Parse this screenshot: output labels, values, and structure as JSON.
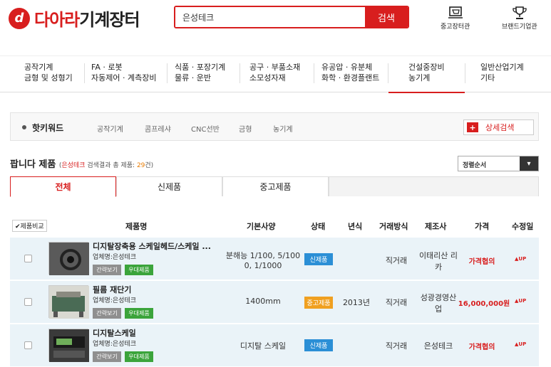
{
  "header": {
    "logo_mark": "d",
    "logo_red": "다아라",
    "logo_dark": "기계장터",
    "search_value": "은성테크",
    "search_button": "검색",
    "icon1_label": "중고장터관",
    "icon2_label": "브랜드기업관"
  },
  "nav": [
    {
      "line1": "공작기계",
      "line2": "금형 및 성형기"
    },
    {
      "line1": "FA · 로봇",
      "line2": "자동제어 · 계측장비"
    },
    {
      "line1": "식품 · 포장기계",
      "line2": "물류 · 운반"
    },
    {
      "line1": "공구 · 부품소재",
      "line2": "소모성자재"
    },
    {
      "line1": "유공압 · 유분체",
      "line2": "화학 · 환경플랜트"
    },
    {
      "line1": "건설중장비",
      "line2": "농기계"
    },
    {
      "line1": "일반산업기계",
      "line2": "기타"
    }
  ],
  "hotkeyword": {
    "title": "핫키워드",
    "keywords": [
      "공작기계",
      "콤프레샤",
      "CNC선반",
      "금형",
      "농기계"
    ],
    "detail_plus": "+",
    "detail_label": "상세검색"
  },
  "sell": {
    "title": "팝니다 제품",
    "paren_open": "(",
    "keyword": "은성테크",
    "mid": " 검색결과 총 제품: ",
    "count": "29",
    "paren_close": "건)"
  },
  "sort": {
    "label": "정렬순서",
    "arrow": "▾"
  },
  "tabs": [
    "전체",
    "신제품",
    "중고제품"
  ],
  "table": {
    "compare": "✔제품비교",
    "headers": [
      "제품명",
      "기본사양",
      "상태",
      "년식",
      "거래방식",
      "제조사",
      "가격",
      "수정일"
    ]
  },
  "rows": [
    {
      "name": "디지탈장축용 스케일헤드/스케일 ...",
      "company": "업체명:은성테크",
      "btn1": "간략보기",
      "btn2": "우대제품",
      "spec1": "분해능 1/100, 5/100",
      "spec2": "0, 1/1000",
      "status": "신제품",
      "status_color": "#2b8fd6",
      "year": "",
      "trade": "직거래",
      "maker1": "이태리산 리",
      "maker2": "카",
      "price": "가격협의",
      "up": "▲UP"
    },
    {
      "name": "필름 재단기",
      "company": "업체명:은성테크",
      "btn1": "간략보기",
      "btn2": "우대제품",
      "spec1": "1400mm",
      "spec2": "",
      "status": "중고제품",
      "status_color": "#f0a020",
      "year": "2013년",
      "trade": "직거래",
      "maker1": "성광경영산",
      "maker2": "업",
      "price": "16,000,000원",
      "up": "▲UP"
    },
    {
      "name": "디지탈스케일",
      "company": "업체명:은성테크",
      "btn1": "간략보기",
      "btn2": "우대제품",
      "spec1": "디지탈 스케일",
      "spec2": "",
      "status": "신제품",
      "status_color": "#2b8fd6",
      "year": "",
      "trade": "직거래",
      "maker1": "은성테크",
      "maker2": "",
      "price": "가격협의",
      "up": "▲UP"
    }
  ]
}
